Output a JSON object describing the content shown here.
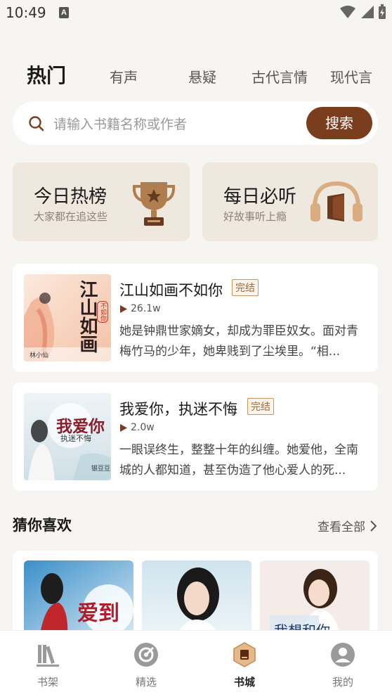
{
  "status": {
    "time": "10:49",
    "a_glyph": "A"
  },
  "tabs": [
    {
      "label": "热门"
    },
    {
      "label": "有声"
    },
    {
      "label": "悬疑"
    },
    {
      "label": "古代言情"
    },
    {
      "label": "现代言"
    }
  ],
  "search": {
    "placeholder": "请输入书籍名称或作者",
    "button": "搜索"
  },
  "features": [
    {
      "title": "今日热榜",
      "subtitle": "大家都在追这些",
      "icon": "trophy-icon"
    },
    {
      "title": "每日必听",
      "subtitle": "好故事听上瘾",
      "icon": "headphones-icon"
    }
  ],
  "books": [
    {
      "title": "江山如画不如你",
      "badge": "完结",
      "plays": "26.1w",
      "desc": "她是钟鼎世家嫡女，却成为罪臣奴女。面对青梅竹马的少年，她卑贱到了尘埃里。“相...",
      "cover_title": "江山如画",
      "cover_sub": "不如你",
      "cover_author": "林小仙"
    },
    {
      "title": "我爱你，执迷不悔",
      "badge": "完结",
      "plays": "2.0w",
      "desc": "一眼误终生，整整十年的纠缠。她爱他，全南城的人都知道，甚至伪造了他心爱人的死...",
      "cover_title": "我爱你",
      "cover_sub": "执迷不悔",
      "cover_author": "银豆豆"
    }
  ],
  "guess": {
    "title": "猜你喜欢",
    "more": "查看全部",
    "covers": [
      {
        "text": "爱到"
      },
      {
        "text": ""
      },
      {
        "text": "我想和你"
      }
    ]
  },
  "nav": [
    {
      "label": "书架",
      "icon": "bookshelf-icon"
    },
    {
      "label": "精选",
      "icon": "featured-icon"
    },
    {
      "label": "书城",
      "icon": "bookstore-icon"
    },
    {
      "label": "我的",
      "icon": "profile-icon"
    }
  ],
  "colors": {
    "accent": "#7a3d1e",
    "badge": "#c9955f",
    "background": "#f7f5f2",
    "card": "#efe8df"
  }
}
